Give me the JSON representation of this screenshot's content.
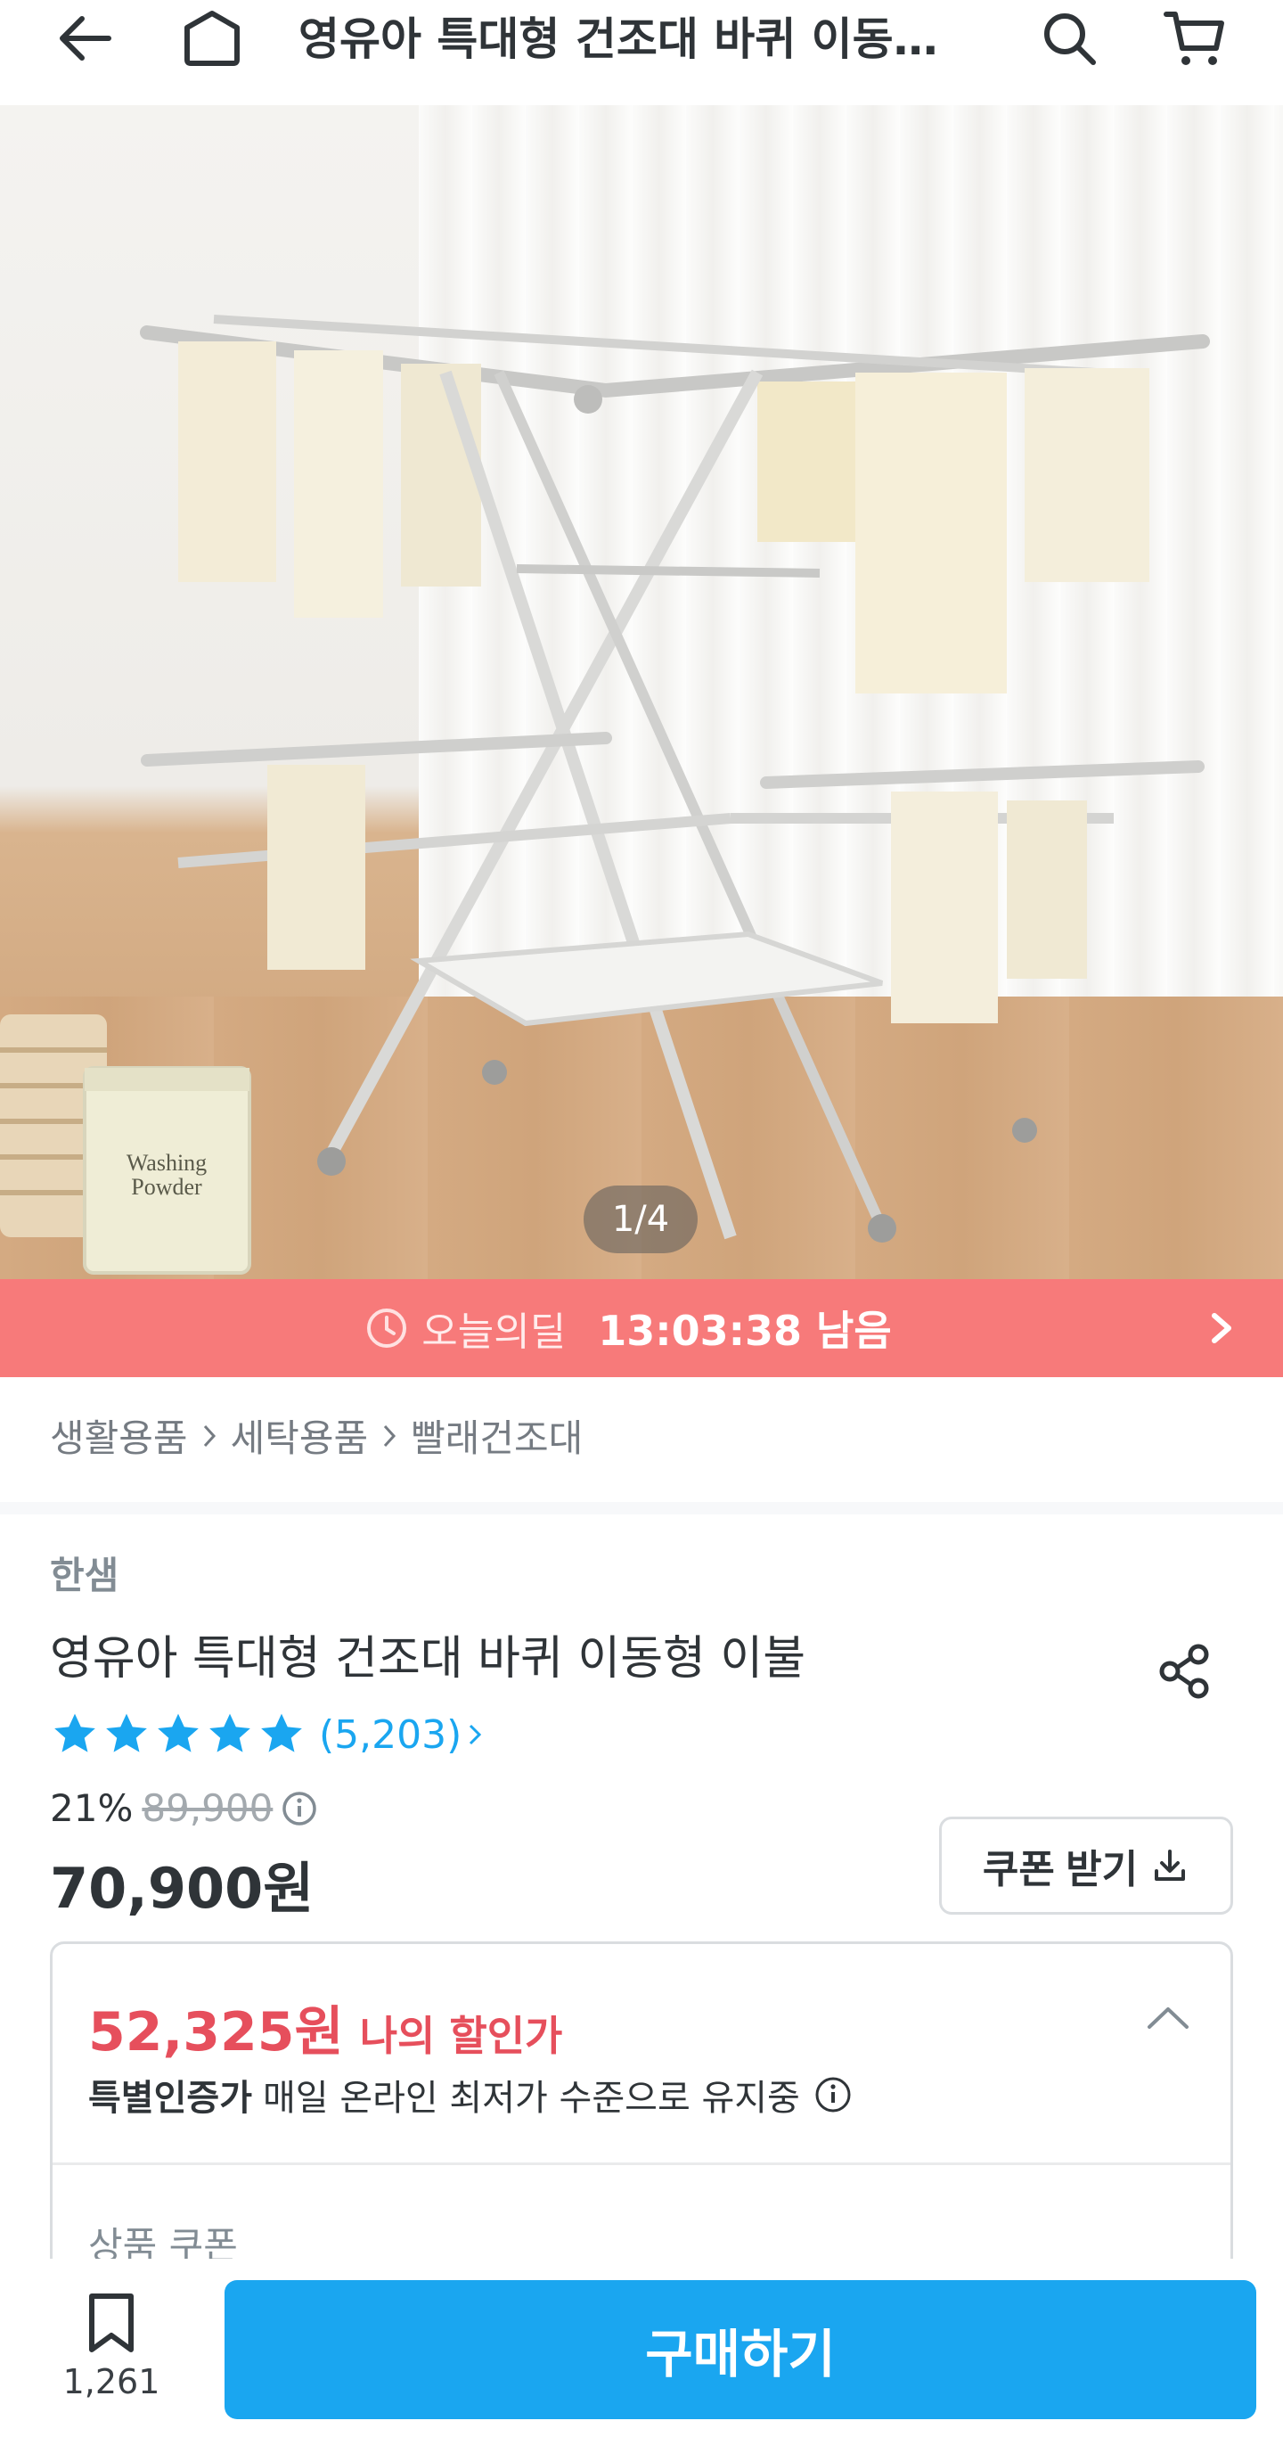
{
  "header": {
    "title": "영유아 특대형 건조대 바퀴 이동…",
    "back_icon": "arrow-left-icon",
    "home_icon": "home-icon",
    "search_icon": "search-icon",
    "cart_icon": "cart-icon"
  },
  "gallery": {
    "pager": "1/4",
    "image_icon": "product-photo",
    "box_label_line1": "Washing",
    "box_label_line2": "Powder"
  },
  "deal": {
    "label": "오늘의딜",
    "time_left": "13:03:38 남음",
    "background": "#f77a7a"
  },
  "breadcrumb": {
    "items": [
      "생활용품",
      "세탁용품",
      "빨래건조대"
    ]
  },
  "product": {
    "brand": "한샘",
    "name": "영유아 특대형 건조대 바퀴 이동형 이불",
    "rating": 5,
    "review_count": "(5,203)",
    "discount_rate": "21%",
    "original_price": "89,900",
    "sale_price": "70,900원",
    "coupon_button": "쿠폰 받기"
  },
  "my_discount": {
    "price": "52,325원",
    "label": "나의 할인가",
    "special_strong": "특별인증가",
    "special_text": "매일 온라인 최저가 수준으로 유지중",
    "coupon_section_title": "상품 쿠폰",
    "accent": "#e64f5c"
  },
  "bottom_bar": {
    "bookmark_count": "1,261",
    "buy_label": "구매하기",
    "accent": "#1aa6f0"
  }
}
